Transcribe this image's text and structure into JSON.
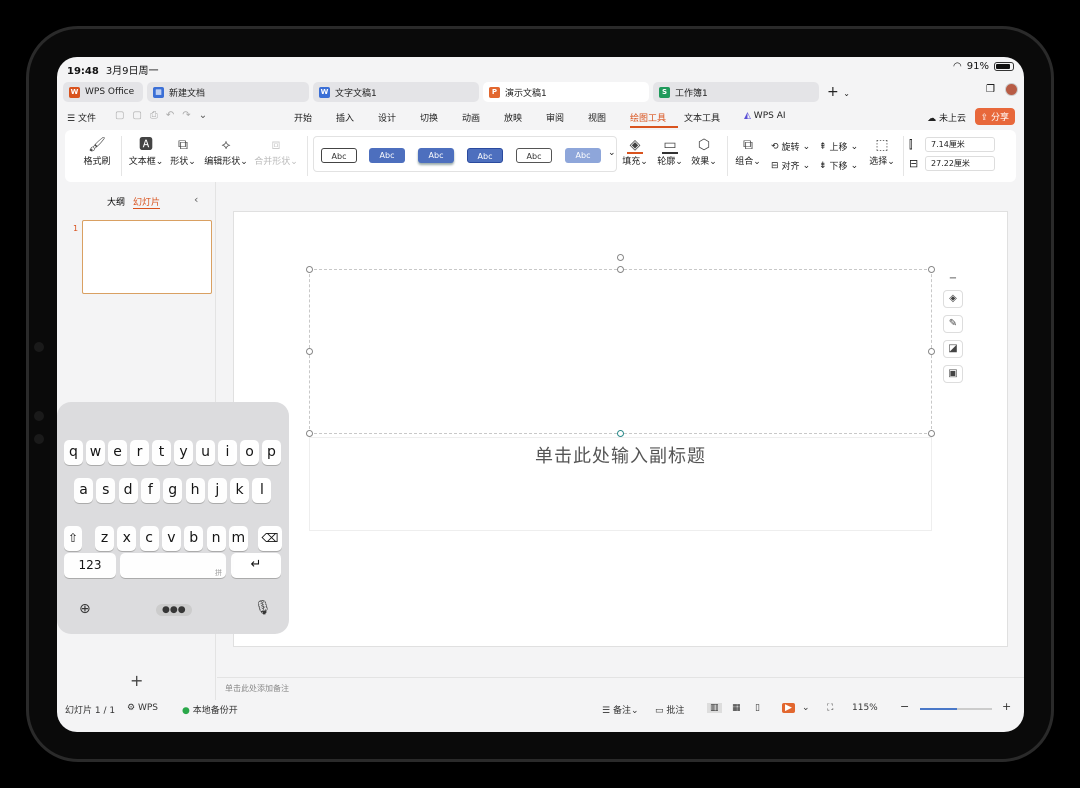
{
  "status": {
    "time": "19:48",
    "date": "3月9日周一",
    "battery": "91%",
    "wifi_icon": "wifi-icon"
  },
  "tabs": [
    {
      "label": "WPS Office",
      "icon": "W",
      "color": "#d9531e"
    },
    {
      "label": "新建文档",
      "icon": "▦",
      "color": "#3b6fd6"
    },
    {
      "label": "文字文稿1",
      "icon": "W",
      "color": "#3b6fd6"
    },
    {
      "label": "演示文稿1",
      "icon": "P",
      "color": "#e2672f"
    },
    {
      "label": "工作簿1",
      "icon": "S",
      "color": "#1f9a5b"
    }
  ],
  "new_tab": "+",
  "menu": {
    "file": "文件",
    "items": [
      "开始",
      "插入",
      "设计",
      "切换",
      "动画",
      "放映",
      "审阅",
      "视图",
      "绘图工具",
      "文本工具",
      "WPS AI"
    ],
    "active": "绘图工具",
    "upload": "未上云",
    "share": "分享"
  },
  "ribbon": {
    "format_painter": "格式刷",
    "textbox": "文本框",
    "shape": "形状",
    "edit_shape": "编辑形状",
    "merge_shape": "合并形状",
    "style_sample": "Abc",
    "fill": "填充",
    "outline": "轮廓",
    "effect": "效果",
    "group": "组合",
    "rotate": "旋转",
    "align": "对齐",
    "move_up": "上移",
    "move_down": "下移",
    "select": "选择",
    "height": "7.14厘米",
    "width": "27.22厘米"
  },
  "left_panel": {
    "outline_tab": "大纲",
    "slides_tab": "幻灯片",
    "slide_number": "1",
    "add": "+"
  },
  "slide": {
    "subtitle_placeholder": "单击此处输入副标题"
  },
  "notes_placeholder": "单击此处添加备注",
  "bottom": {
    "slide_counter": "幻灯片 1 / 1",
    "wps": "WPS",
    "backup": "本地备份开",
    "notes": "备注",
    "comments": "批注",
    "zoom": "115%",
    "zoom_level": 0.52
  },
  "keyboard": {
    "row1": [
      "q",
      "w",
      "e",
      "r",
      "t",
      "y",
      "u",
      "i",
      "o",
      "p"
    ],
    "row2": [
      "a",
      "s",
      "d",
      "f",
      "g",
      "h",
      "j",
      "k",
      "l"
    ],
    "row3": [
      "z",
      "x",
      "c",
      "v",
      "b",
      "n",
      "m"
    ],
    "numbers": "123",
    "pinyin": "拼"
  }
}
